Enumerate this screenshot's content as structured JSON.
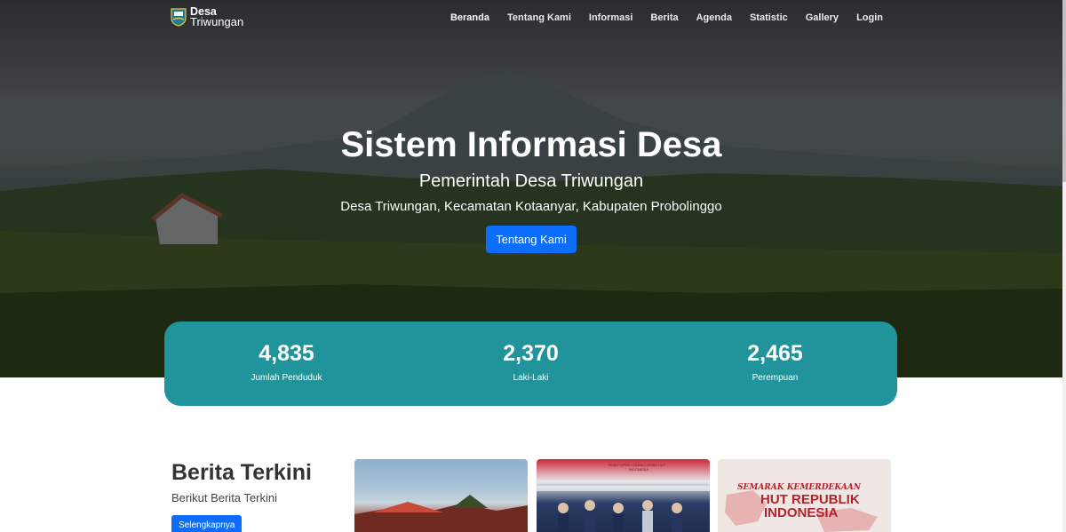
{
  "brand": {
    "line1": "Desa",
    "line2": "Triwungan"
  },
  "nav": {
    "items": [
      {
        "label": "Beranda"
      },
      {
        "label": "Tentang Kami"
      },
      {
        "label": "Informasi"
      },
      {
        "label": "Berita"
      },
      {
        "label": "Agenda"
      },
      {
        "label": "Statistic"
      },
      {
        "label": "Gallery"
      },
      {
        "label": "Login"
      }
    ]
  },
  "hero": {
    "title": "Sistem Informasi Desa",
    "subtitle": "Pemerintah Desa Triwungan",
    "location": "Desa Triwungan, Kecamatan Kotaanyar, Kabupaten Probolinggo",
    "button": "Tentang Kami"
  },
  "stats": [
    {
      "value": "4,835",
      "label": "Jumlah Penduduk"
    },
    {
      "value": "2,370",
      "label": "Laki-Laki"
    },
    {
      "value": "2,465",
      "label": "Perempuan"
    }
  ],
  "news": {
    "title": "Berita Terkini",
    "subtitle": "Berikut Berita Terkini",
    "button": "Selengkapnya",
    "cards": [
      {
        "image_text": ""
      },
      {
        "image_text": "PEMUTUPAN LOMBA-LOMBA HUT ... INDONESIA"
      },
      {
        "line1": "SEMARAK KEMERDEKAAN",
        "line2": "HUT REPUBLIK",
        "line3": "INDONESIA"
      }
    ]
  },
  "colors": {
    "accent": "#0d6efd",
    "stats_bg": "#20949a"
  }
}
